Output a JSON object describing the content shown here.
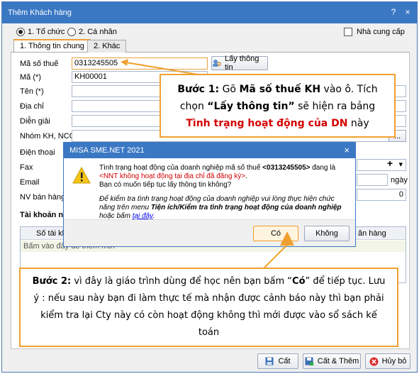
{
  "window": {
    "title": "Thêm Khách hàng",
    "help_label": "?",
    "close_label": "×"
  },
  "customer_type": {
    "option1": "1. Tổ chức",
    "option2": "2. Cá nhân",
    "supplier_label": "Nhà cung cấp"
  },
  "tabs": {
    "tab1": "1. Thông tin chung",
    "tab2": "2. Khác"
  },
  "form": {
    "tax_code_label": "Mã số thuế",
    "tax_code_value": "0313245505",
    "get_info_button": "Lấy thông tin",
    "code_label": "Mã (*)",
    "code_value": "KH00001",
    "name_label": "Tên (*)",
    "address_label": "Địa chỉ",
    "description_label": "Diễn giải",
    "group_label": "Nhóm KH, NCC",
    "phone_label": "Điện thoại",
    "fax_label": "Fax",
    "email_label": "Email",
    "sales_staff_label": "NV bán hàng",
    "days_label": "ngày",
    "zero_value": "0",
    "ellipsis": "...",
    "plus": "+",
    "dropdown": "▾",
    "bank_accounts_label": "Tài khoản ngân",
    "grid_col1": "Số tài khoả",
    "grid_col2": "ân hàng",
    "grid_hint": "Bấm vào đây để thêm mới"
  },
  "callout1": {
    "line1_prefix": "Bước 1:",
    "line1_mid": " Gõ ",
    "line1_bold": "Mã số thuế KH",
    "line1_suffix": " vào ô. Tích",
    "line2_prefix": "chọn ",
    "line2_bold": "“Lấy thông tin”",
    "line2_suffix": " sẽ hiện ra bảng",
    "line3_red": "Tình trạng hoạt động của DN",
    "line3_suffix": " này"
  },
  "dialog": {
    "title": "MISA SME.NET 2021",
    "close_label": "×",
    "msg1_a": "Tình trạng hoạt động của doanh nghiệp mã số thuế ",
    "msg1_code": "<0313245505>",
    "msg1_b": " đang là ",
    "msg1_red": "<NNT không hoạt động tại địa chỉ đã đăng ký>",
    "msg1_c": ".",
    "msg2": "Bạn có muốn tiếp tục lấy thông tin không?",
    "msg3_a": "Để kiểm tra tình trạng hoạt động của doanh nghiệp vui lòng thực hiện chức năng trên menu ",
    "msg3_bold": "Tiện ích/Kiểm tra tình trạng hoạt động của doanh nghiệp",
    "msg3_b": " hoặc bấm ",
    "msg3_link": "tại đây",
    "msg3_c": ".",
    "yes_button": "Có",
    "no_button": "Không"
  },
  "callout2": {
    "bold1": "Bước 2:",
    "text1": " vì đây là giáo trình dùng để học nên bạn bấm “",
    "bold2": "Có",
    "text2": "” để tiếp tục. Lưu ý : nếu sau này bạn đi làm thực tế mà nhận được cảnh báo này thì bạn phải kiểm tra lại Cty này có còn hoạt động không thì mới được vào sổ sách kế toán"
  },
  "footer": {
    "save_button": "Cất",
    "save_add_button": "Cất & Thêm",
    "cancel_button": "Hủy bỏ"
  },
  "colors": {
    "title_bar": "#3b78c4",
    "callout_border": "#f0a030",
    "warning_red": "#d40000"
  }
}
